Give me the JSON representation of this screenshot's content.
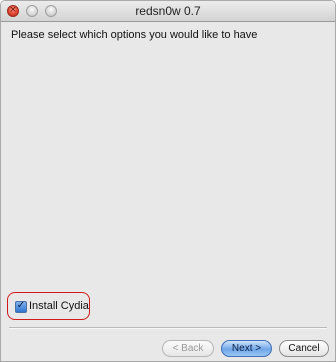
{
  "window": {
    "title": "redsn0w 0.7",
    "controls": [
      {
        "name": "close",
        "color": "#e0442f"
      },
      {
        "name": "minimize",
        "color": "#d6d6d6"
      },
      {
        "name": "zoom",
        "color": "#d6d6d6"
      }
    ]
  },
  "content": {
    "prompt": "Please select which options you would like to have",
    "options": [
      {
        "label": "Install Cydia",
        "checked": true,
        "highlight_color": "#d11a1a"
      }
    ]
  },
  "buttons": {
    "back": {
      "label": "< Back",
      "enabled": false
    },
    "next": {
      "label": "Next >",
      "default": true
    },
    "cancel": {
      "label": "Cancel"
    }
  }
}
